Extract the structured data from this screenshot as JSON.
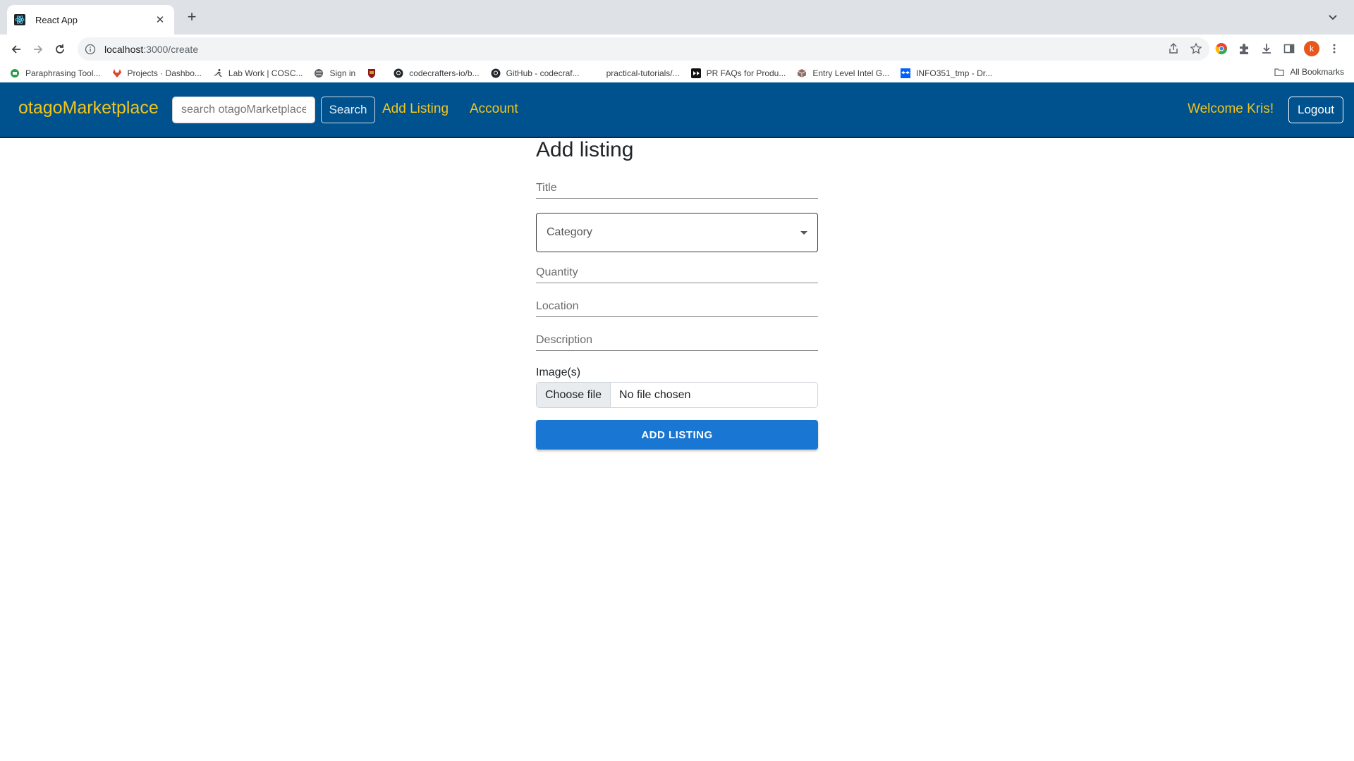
{
  "browser": {
    "tab_title": "React App",
    "url_host": "localhost",
    "url_path": ":3000/create",
    "new_tab_symbol": "+",
    "avatar_letter": "k",
    "bookmarks": [
      {
        "label": "Paraphrasing Tool...",
        "icon": "paraphrase-icon"
      },
      {
        "label": "Projects · Dashbo...",
        "icon": "gitlab-icon"
      },
      {
        "label": "Lab Work | COSC...",
        "icon": "runner-icon"
      },
      {
        "label": "Sign in",
        "icon": "globe-icon"
      },
      {
        "label": "",
        "icon": "crest-icon"
      },
      {
        "label": "codecrafters-io/b...",
        "icon": "github-icon"
      },
      {
        "label": "GitHub - codecraf...",
        "icon": "github-icon"
      },
      {
        "label": "practical-tutorials/...",
        "icon": "blank-icon"
      },
      {
        "label": "PR FAQs for Produ...",
        "icon": "media-icon"
      },
      {
        "label": "Entry Level Intel G...",
        "icon": "box-icon"
      },
      {
        "label": "INFO351_tmp - Dr...",
        "icon": "dropbox-icon"
      }
    ],
    "all_bookmarks_label": "All Bookmarks"
  },
  "navbar": {
    "brand": "otagoMarketplace",
    "search_placeholder": "search otagoMarketplace",
    "search_button": "Search",
    "add_listing_link": "Add Listing",
    "account_link": "Account",
    "welcome_text": "Welcome Kris!",
    "logout_button": "Logout",
    "colors": {
      "bar": "#00528f",
      "accent": "#f5c518"
    }
  },
  "form": {
    "heading": "Add listing",
    "title_label": "Title",
    "category_label": "Category",
    "quantity_label": "Quantity",
    "location_label": "Location",
    "description_label": "Description",
    "images_label": "Image(s)",
    "choose_file_button": "Choose file",
    "file_status": "No file chosen",
    "submit_button": "ADD LISTING",
    "submit_color": "#1976d2"
  }
}
